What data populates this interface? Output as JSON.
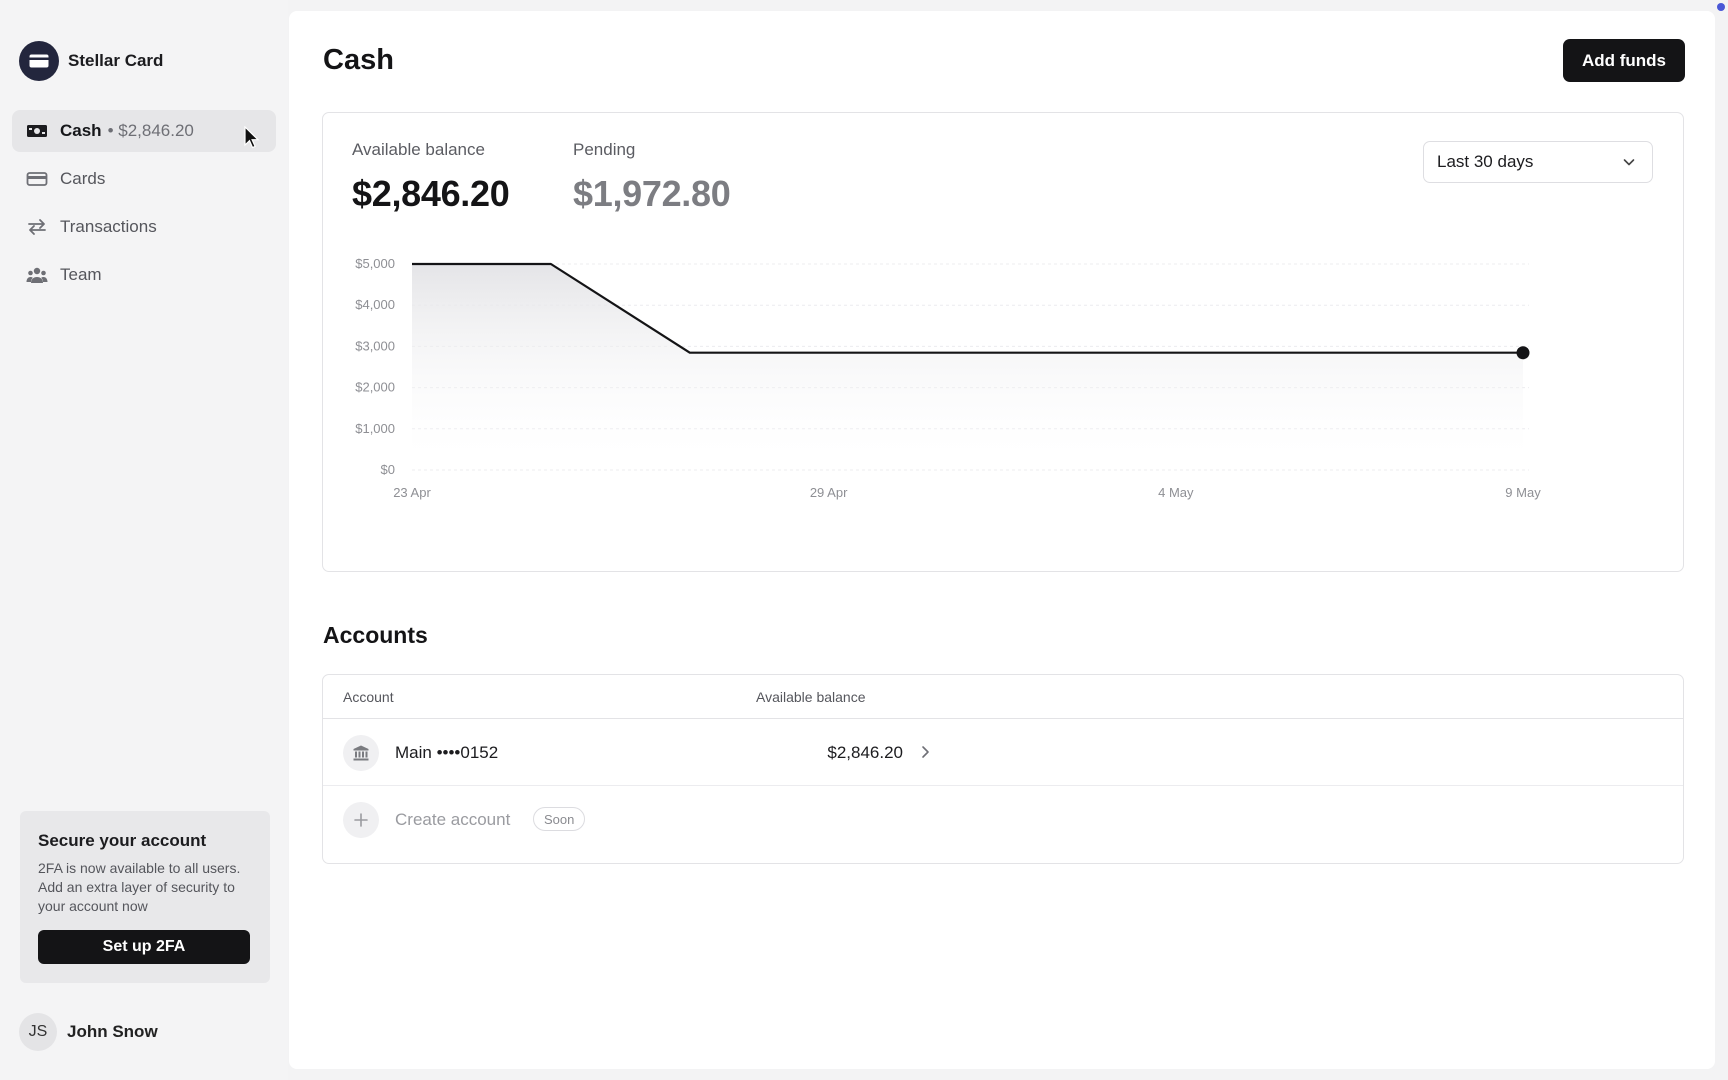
{
  "sidebar": {
    "brand": "Stellar Card",
    "items": [
      {
        "label": "Cash",
        "sub": "• $2,846.20",
        "icon": "banknote-icon"
      },
      {
        "label": "Cards",
        "icon": "card-icon"
      },
      {
        "label": "Transactions",
        "icon": "arrows-icon"
      },
      {
        "label": "Team",
        "icon": "users-icon"
      }
    ],
    "promo": {
      "title": "Secure your account",
      "text": "2FA is now available to all users. Add an extra layer of security to your account now",
      "button": "Set up 2FA"
    },
    "user": {
      "initials": "JS",
      "name": "John Snow"
    }
  },
  "header": {
    "title": "Cash",
    "add_funds": "Add funds"
  },
  "balances": {
    "available_label": "Available balance",
    "available_value": "$2,846.20",
    "pending_label": "Pending",
    "pending_value": "$1,972.80",
    "range": "Last 30 days"
  },
  "chart_data": {
    "type": "area",
    "x": [
      "23 Apr",
      "25 Apr",
      "27 Apr",
      "9 May"
    ],
    "values": [
      5000,
      5000,
      2846.2,
      2846.2
    ],
    "x_ticks": [
      "23 Apr",
      "29 Apr",
      "4 May",
      "9 May"
    ],
    "y_ticks": [
      "$0",
      "$1,000",
      "$2,000",
      "$3,000",
      "$4,000",
      "$5,000"
    ],
    "ylim": [
      0,
      5000
    ],
    "grid": true,
    "line_color": "#141416"
  },
  "accounts": {
    "title": "Accounts",
    "columns": [
      "Account",
      "Available balance"
    ],
    "rows": [
      {
        "name": "Main ••••0152",
        "balance": "$2,846.20"
      }
    ],
    "create": {
      "label": "Create account",
      "badge": "Soon"
    }
  }
}
